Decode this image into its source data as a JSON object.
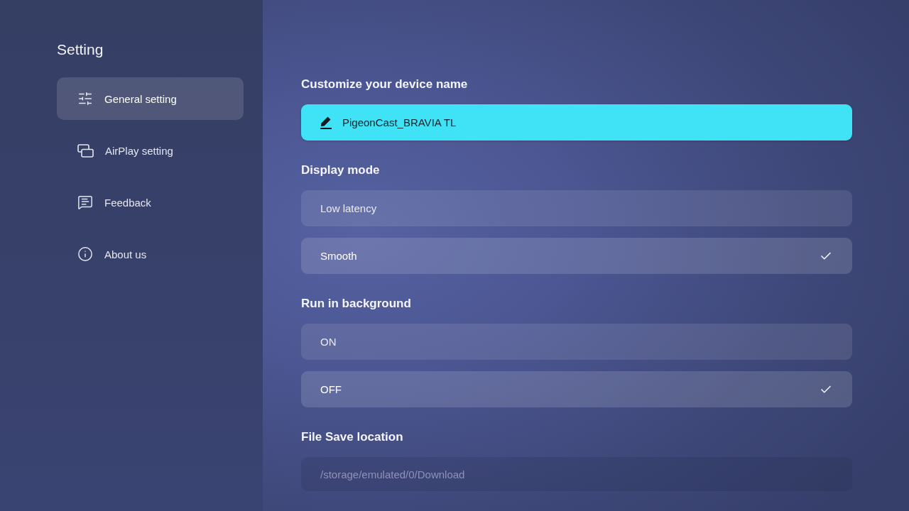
{
  "sidebar": {
    "title": "Setting",
    "items": [
      {
        "label": "General setting",
        "selected": true
      },
      {
        "label": "AirPlay setting",
        "selected": false
      },
      {
        "label": "Feedback",
        "selected": false
      },
      {
        "label": "About us",
        "selected": false
      }
    ]
  },
  "sections": [
    {
      "title": "Customize your device name",
      "kind": "name_field",
      "value": "PigeonCast_BRAVIA TL"
    },
    {
      "title": "Display mode",
      "kind": "options",
      "options": [
        {
          "label": "Low latency",
          "selected": false
        },
        {
          "label": "Smooth",
          "selected": true
        }
      ]
    },
    {
      "title": "Run in background",
      "kind": "options",
      "options": [
        {
          "label": "ON",
          "selected": false
        },
        {
          "label": "OFF",
          "selected": true
        }
      ]
    },
    {
      "title": "File Save location",
      "kind": "path_field",
      "value": "/storage/emulated/0/Download",
      "disabled": true
    }
  ]
}
